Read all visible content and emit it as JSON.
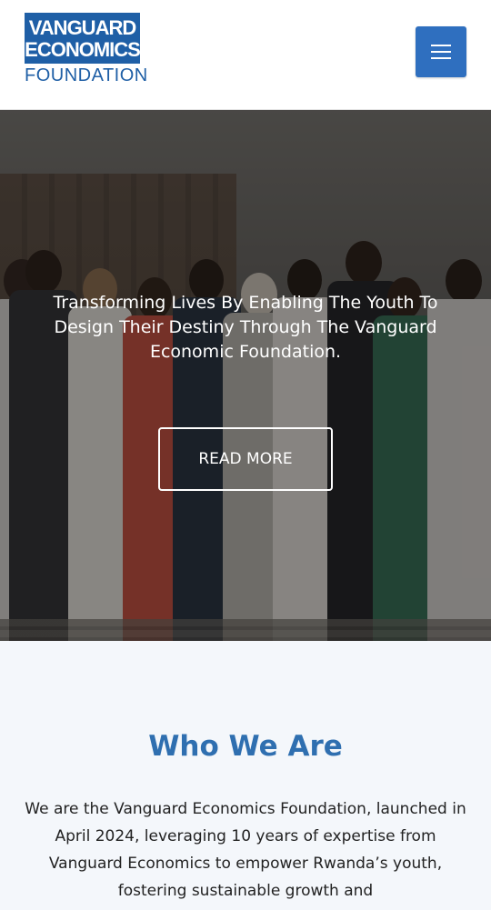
{
  "header": {
    "logo_line1": "VANGUARD",
    "logo_line2": "ECONOMICS",
    "logo_line3": "FOUNDATION",
    "menu_icon": "hamburger-menu-icon"
  },
  "hero": {
    "title": "Transforming Lives By Enabling The Youth To Design Their Destiny Through The Vanguard Economic Foundation.",
    "button_label": "READ MORE"
  },
  "who_we_are": {
    "heading": "Who We Are",
    "body": "We are the Vanguard Economics Foundation, launched in April 2024, leveraging 10 years of expertise from Vanguard Economics to empower Rwanda’s youth, fostering sustainable growth and"
  },
  "colors": {
    "brand_blue": "#1f5fa6",
    "menu_button": "#2f6fbf",
    "heading_blue": "#2f6fb0",
    "section_background": "#f4f7fb"
  }
}
